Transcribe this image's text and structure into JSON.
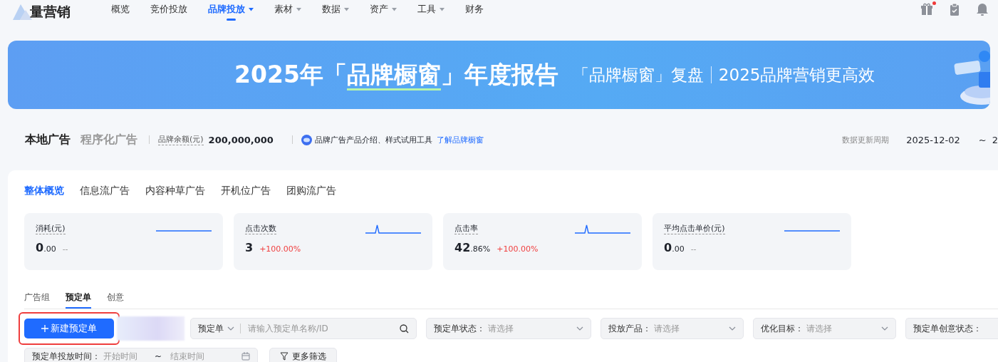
{
  "nav": {
    "logo_text": "量营销",
    "items": [
      {
        "label": "概览",
        "selected": false,
        "dropdown": false
      },
      {
        "label": "竞价投放",
        "selected": false,
        "dropdown": false
      },
      {
        "label": "品牌投放",
        "selected": true,
        "dropdown": true
      },
      {
        "label": "素材",
        "selected": false,
        "dropdown": true
      },
      {
        "label": "数据",
        "selected": false,
        "dropdown": true
      },
      {
        "label": "资产",
        "selected": false,
        "dropdown": true
      },
      {
        "label": "工具",
        "selected": false,
        "dropdown": true
      },
      {
        "label": "财务",
        "selected": false,
        "dropdown": false
      }
    ],
    "icons": [
      {
        "kind": "gift",
        "badge": true
      },
      {
        "kind": "clipboard",
        "badge": false
      },
      {
        "kind": "bell",
        "badge": false
      }
    ]
  },
  "banner": {
    "title_pre": "2025年「",
    "title_highlight": "品牌橱窗",
    "title_post": "」年度报告",
    "subtitle_left": "「品牌橱窗」复盘",
    "subtitle_right": "2025品牌营销更高效"
  },
  "header": {
    "tabs": [
      {
        "label": "本地广告",
        "selected": true
      },
      {
        "label": "程序化广告",
        "selected": false
      }
    ],
    "balance_label": "品牌余额(元)",
    "balance_value": "200,000,000",
    "intro_text": "品牌广告产品介绍、样式试用工具",
    "intro_link": "了解品牌橱窗",
    "update_label": "数据更新周期",
    "date_start": "2025-12-02",
    "date_separator": "~",
    "date_end": "2"
  },
  "overview_tabs": [
    {
      "label": "整体概览",
      "selected": true
    },
    {
      "label": "信息流广告",
      "selected": false
    },
    {
      "label": "内容种草广告",
      "selected": false
    },
    {
      "label": "开机位广告",
      "selected": false
    },
    {
      "label": "团购流广告",
      "selected": false
    }
  ],
  "metrics": [
    {
      "title": "消耗(元)",
      "value_main": "0",
      "value_fraction": ".00",
      "change": "--",
      "rising": false,
      "spike": false
    },
    {
      "title": "点击次数",
      "value_main": "3",
      "change": "+100.00%",
      "rising": true,
      "spike": true
    },
    {
      "title": "点击率",
      "value_main": "42",
      "value_fraction": ".86%",
      "change": "+100.00%",
      "rising": true,
      "spike": true
    },
    {
      "title": "平均点击单价(元)",
      "value_main": "0",
      "value_fraction": ".00",
      "change": "--",
      "rising": false,
      "spike": false
    }
  ],
  "sub_tabs": [
    {
      "label": "广告组",
      "selected": false
    },
    {
      "label": "预定单",
      "selected": true
    },
    {
      "label": "创意",
      "selected": false
    }
  ],
  "toolbar": {
    "new_button": "新建预定单",
    "highlighted": true,
    "search": {
      "scope": "预定单",
      "placeholder": "请输入预定单名称/ID"
    },
    "filters": [
      {
        "label": "预定单状态：",
        "placeholder": "请选择"
      },
      {
        "label": "投放产品：",
        "placeholder": "请选择"
      },
      {
        "label": "优化目标：",
        "placeholder": "请选择"
      },
      {
        "label": "预定单创意状态："
      }
    ],
    "date_range": {
      "label": "预定单投放时间：",
      "start_placeholder": "开始时间",
      "separator": "~",
      "end_placeholder": "结束时间"
    },
    "more_filters": "更多筛选"
  }
}
